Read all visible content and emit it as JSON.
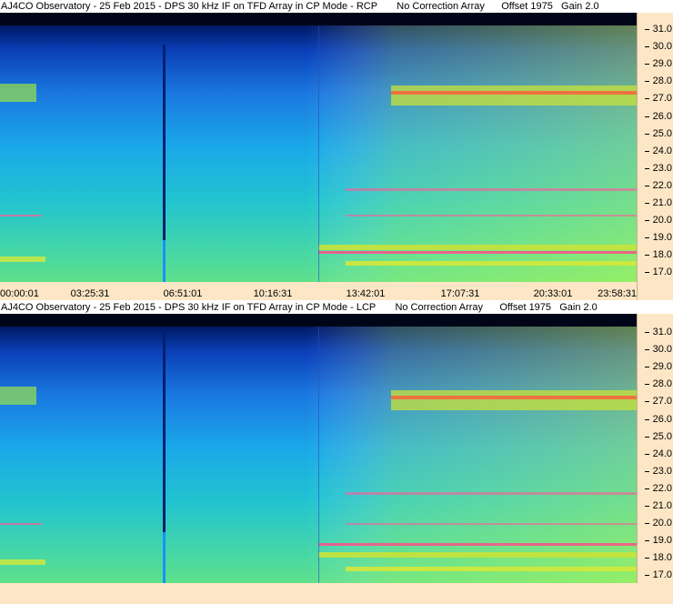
{
  "panels": {
    "rcp": {
      "title": "AJ4CO Observatory - 25 Feb 2015 - DPS 30 kHz IF on TFD Array in CP Mode - RCP       No Correction Array      Offset 1975   Gain 2.0",
      "freq_ticks": [
        "31.0",
        "30.0",
        "29.0",
        "28.0",
        "27.0",
        "26.0",
        "25.0",
        "24.0",
        "23.0",
        "22.0",
        "21.0",
        "20.0",
        "19.0",
        "18.0",
        "17.0"
      ],
      "time_ticks": [
        "00:00:01",
        "03:25:31",
        "06:51:01",
        "10:16:31",
        "13:42:01",
        "17:07:31",
        "20:33:01",
        "23:58:31"
      ]
    },
    "lcp": {
      "title": "AJ4CO Observatory - 25 Feb 2015 - DPS 30 kHz IF on TFD Array in CP Mode - LCP       No Correction Array      Offset 1975   Gain 2.0",
      "freq_ticks": [
        "31.0",
        "30.0",
        "29.0",
        "28.0",
        "27.0",
        "26.0",
        "25.0",
        "24.0",
        "23.0",
        "22.0",
        "21.0",
        "20.0",
        "19.0",
        "18.0",
        "17.0"
      ]
    }
  },
  "colors": {
    "axis_bg": "#fde6c6",
    "low": "#000033",
    "mid": "#1e90ff",
    "high": "#ffff33",
    "peak": "#ff3399"
  }
}
